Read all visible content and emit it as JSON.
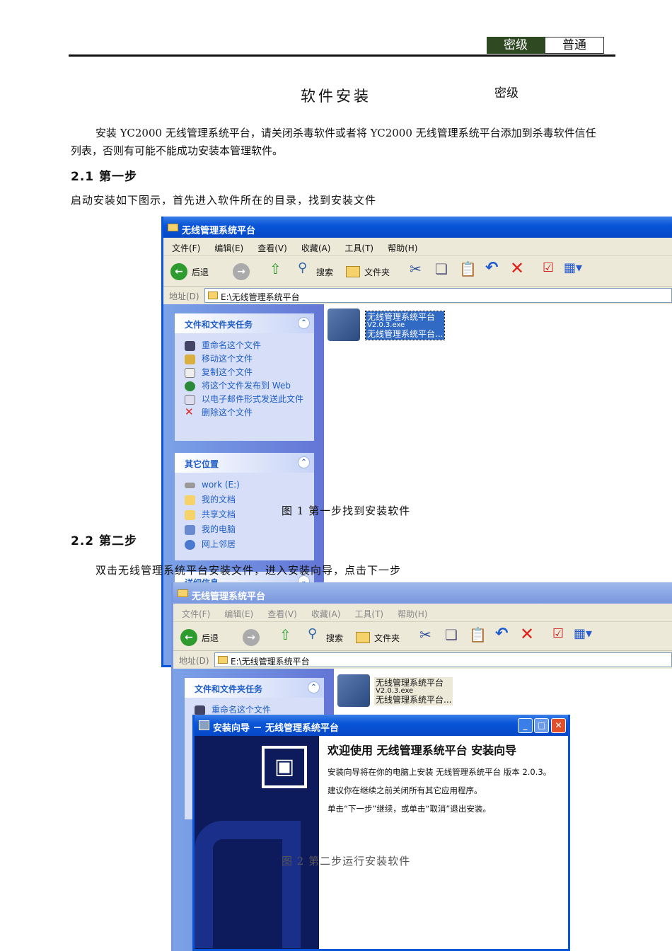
{
  "header": {
    "badge_label": "密级",
    "badge_value": "普通"
  },
  "doc": {
    "title": "软件安装",
    "title_side": "密级",
    "intro": "安装 YC2000 无线管理系统平台，请关闭杀毒软件或者将 YC2000 无线管理系统平台添加到杀毒软件信任列表，否则有可能不能成功安装本管理软件。",
    "s1_heading": "2.1 第一步",
    "s1_text": "启动安装如下图示，首先进入软件所在的目录，找到安装文件",
    "fig1_caption": "图 1  第一步找到安装软件",
    "s2_heading": "2.2 第二步",
    "s2_text": "双击无线管理系统平台安装文件，进入安装向导，点击下一步",
    "fig2_caption": "图 2  第二步运行安装软件"
  },
  "explorer": {
    "title": "无线管理系统平台",
    "menu": [
      "文件(F)",
      "编辑(E)",
      "查看(V)",
      "收藏(A)",
      "工具(T)",
      "帮助(H)"
    ],
    "back": "后退",
    "search": "搜索",
    "folders": "文件夹",
    "address_label": "地址(D)",
    "address": "E:\\无线管理系统平台",
    "tasks_title": "文件和文件夹任务",
    "tasks": [
      "重命名这个文件",
      "移动这个文件",
      "复制这个文件",
      "将这个文件发布到 Web",
      "以电子邮件形式发送此文件",
      "删除这个文件"
    ],
    "places_title": "其它位置",
    "places": [
      "work (E:)",
      "我的文档",
      "共享文档",
      "我的电脑",
      "网上邻居"
    ],
    "details_title": "详细信息",
    "file": {
      "line1": "无线管理系统平台",
      "line2": "V2.0.3.exe",
      "line3": "无线管理系统平台..."
    }
  },
  "wizard": {
    "title": "安装向导 － 无线管理系统平台",
    "heading": "欢迎使用 无线管理系统平台 安装向导",
    "p1": "安装向导将在你的电脑上安装 无线管理系统平台 版本 2.0.3。",
    "p2": "建议你在继续之前关闭所有其它应用程序。",
    "p3": "单击“下一步”继续，或单击“取消”退出安装。"
  }
}
